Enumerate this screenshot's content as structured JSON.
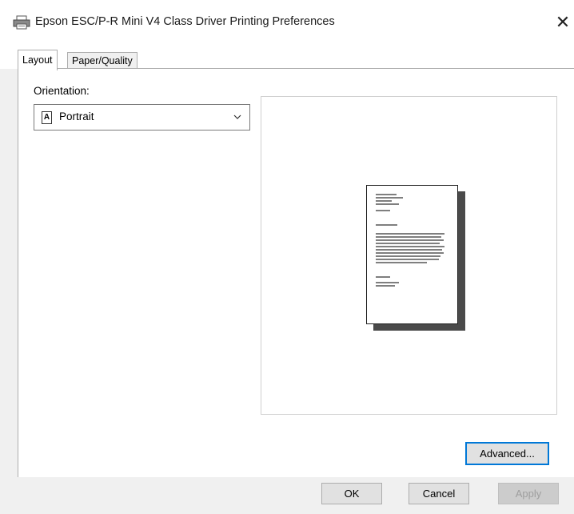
{
  "window": {
    "title": "Epson ESC/P-R Mini V4 Class Driver Printing Preferences",
    "close_glyph": "✕",
    "title_icon": "printer-icon"
  },
  "tabs": [
    {
      "label": "Layout",
      "selected": true
    },
    {
      "label": "Paper/Quality",
      "selected": false
    }
  ],
  "layout": {
    "orientation_label": "Orientation:",
    "orientation_value": "Portrait",
    "orientation_icon_glyph": "A",
    "advanced_label": "Advanced..."
  },
  "footer": {
    "ok_label": "OK",
    "cancel_label": "Cancel",
    "apply_label": "Apply",
    "apply_enabled": false
  },
  "colors": {
    "focus_border": "#0078d7",
    "dialog_bg": "#f0f0f0"
  }
}
